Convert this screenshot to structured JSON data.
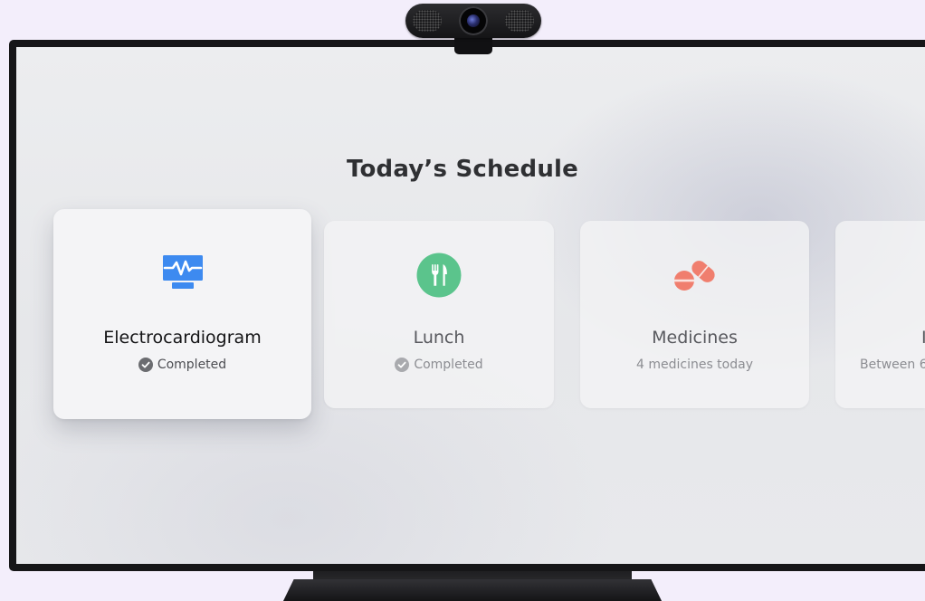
{
  "page": {
    "title": "Today’s Schedule"
  },
  "cards": [
    {
      "title": "Electrocardiogram",
      "subtitle": "Completed",
      "icon": "ecg-monitor-icon",
      "status_icon": "check-circle-icon",
      "focused": true,
      "icon_color": "#3d8af0"
    },
    {
      "title": "Lunch",
      "subtitle": "Completed",
      "icon": "fork-knife-icon",
      "status_icon": "check-circle-icon",
      "focused": false,
      "icon_color": "#5bc48c"
    },
    {
      "title": "Medicines",
      "subtitle": "4 medicines today",
      "icon": "pills-icon",
      "focused": false,
      "icon_color": "#f07e6e"
    },
    {
      "title": "I",
      "subtitle": "Between 6",
      "focused": false
    }
  ],
  "colors": {
    "background": "#f3eefb",
    "screen": "#e8e9ec",
    "ecg_blue": "#3d8af0",
    "lunch_green": "#5bc48c",
    "medicine_coral": "#f07e6e"
  }
}
